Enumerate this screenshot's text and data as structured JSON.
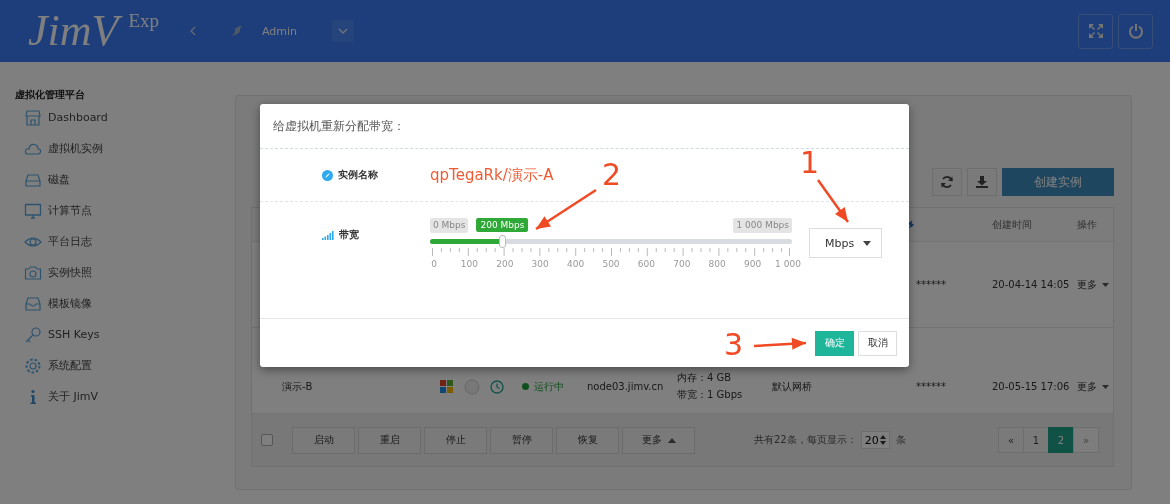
{
  "header": {
    "logo": "JimV",
    "logo_suffix": "Exp",
    "user": "Admin"
  },
  "sidebar": {
    "title": "虚拟化管理平台",
    "items": [
      {
        "label": "Dashboard"
      },
      {
        "label": "虚拟机实例"
      },
      {
        "label": "磁盘"
      },
      {
        "label": "计算节点"
      },
      {
        "label": "平台日志"
      },
      {
        "label": "实例快照"
      },
      {
        "label": "模板镜像"
      },
      {
        "label": "SSH Keys"
      },
      {
        "label": "系统配置"
      },
      {
        "label": "关于 JimV"
      }
    ]
  },
  "toolbar": {
    "create_button": "创建实例"
  },
  "table": {
    "columns": [
      "创建时间",
      "操作"
    ],
    "rows": [
      {
        "password": "******",
        "created": "20-04-14 14:05",
        "action": "更多"
      },
      {
        "name": "演示-B",
        "status": "运行中",
        "host": "node03.jimv.cn",
        "memory": "内存：4 GB",
        "bandwidth": "带宽：1 Gbps",
        "network": "默认网桥",
        "password": "******",
        "created": "20-05-15 17:06",
        "action": "更多"
      }
    ]
  },
  "footer": {
    "checked": false,
    "buttons": [
      "启动",
      "重启",
      "停止",
      "暂停",
      "恢复"
    ],
    "more": "更多",
    "summary": "共有22条，每页显示：",
    "page_size": "20",
    "unit": "条",
    "pages": [
      {
        "label": "«",
        "selected": false,
        "disabled": false
      },
      {
        "label": "1",
        "selected": false,
        "disabled": false
      },
      {
        "label": "2",
        "selected": true,
        "disabled": false
      },
      {
        "label": "»",
        "selected": false,
        "disabled": true
      }
    ]
  },
  "modal": {
    "title": "给虚拟机重新分配带宽：",
    "fields": [
      {
        "kind": "text",
        "label": "实例名称",
        "value": "qpTegaRk/演示-A"
      },
      {
        "kind": "slider",
        "label": "带宽",
        "min_label": "0 Mbps",
        "max_label": "1 000 Mbps",
        "value_label": "200 Mbps",
        "level": 0.2,
        "ticks": [
          "0",
          "100",
          "200",
          "300",
          "400",
          "500",
          "600",
          "700",
          "800",
          "900",
          "1 000"
        ],
        "unit": "Mbps"
      }
    ],
    "buttons": [
      {
        "kind": "primary",
        "label": "确定"
      },
      {
        "kind": "default",
        "label": "取消"
      }
    ]
  },
  "annotations": [
    {
      "label": "1"
    },
    {
      "label": "2"
    },
    {
      "label": "3"
    }
  ]
}
